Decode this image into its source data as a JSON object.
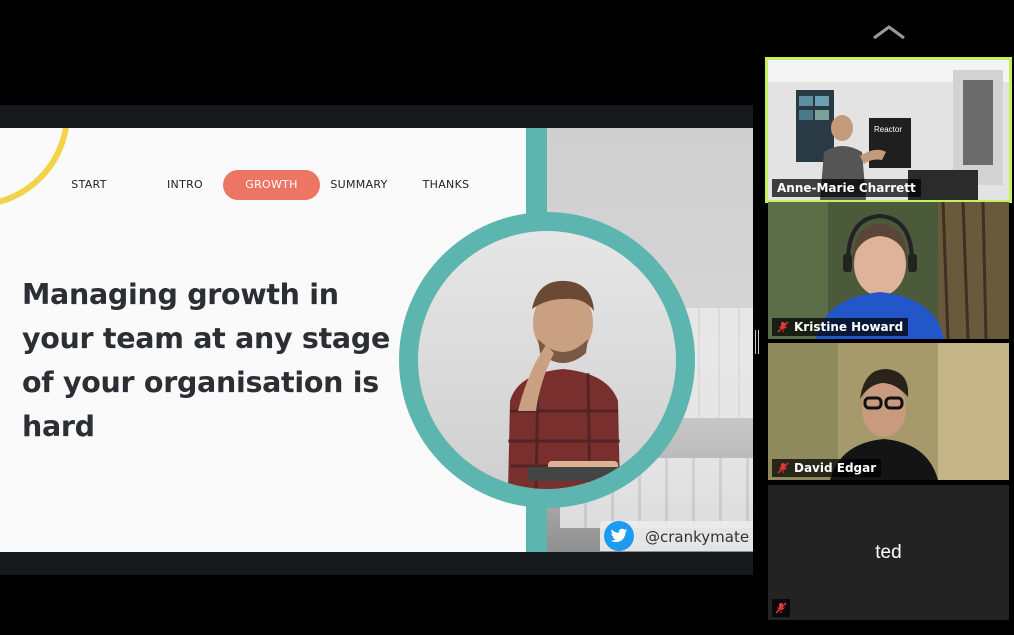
{
  "slide": {
    "nav": [
      {
        "label": "START"
      },
      {
        "label": "INTRO"
      },
      {
        "label": "GROWTH",
        "active": true
      },
      {
        "label": "SUMMARY"
      },
      {
        "label": "THANKS"
      }
    ],
    "headline": "Managing growth in your team at any stage of your organisation is hard",
    "twitter_handle": "@crankymate",
    "colors": {
      "accent": "#ec7663",
      "teal": "#5db5af",
      "arc": "#f3d34a"
    }
  },
  "participants": [
    {
      "name": "Anne-Marie Charrett",
      "speaking": true,
      "video": true
    },
    {
      "name": "Kristine Howard",
      "muted": true,
      "video": true
    },
    {
      "name": "David Edgar",
      "muted": true,
      "video": true
    },
    {
      "name": "ted",
      "muted": true,
      "video": false
    }
  ],
  "icons": {
    "collapse": "chevron-up-icon",
    "mute": "mic-muted-icon",
    "twitter": "twitter-bird-icon"
  }
}
